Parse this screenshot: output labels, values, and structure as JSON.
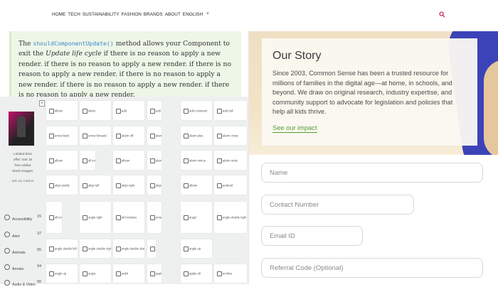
{
  "nav": {
    "items": [
      "HOME",
      "TECH",
      "SUSTAINABILITY",
      "FASHION",
      "BRANDS",
      "ABOUT",
      "ENGLISH"
    ],
    "chevron": "˅",
    "search_icon": "search-icon",
    "accent": "#c2185b"
  },
  "code": {
    "pre": "The ",
    "method": "shouldComponentUpdate()",
    "mid": " method allows your Component to exit the ",
    "em": "Update life cycle",
    "post": " if there is no reason to apply a new render. if there is no reason to apply a new render. if there is no reason to apply a new render. if there is no reason to apply a new render. if there is no reason to apply a new render. if there is no reason to apply a new render."
  },
  "ad": {
    "close": "x",
    "text": "Limited time offer: Get 10 free Adobe Stock images.",
    "by": "ads via Carbon"
  },
  "categories": [
    {
      "label": "Accessibility",
      "count": "15"
    },
    {
      "label": "Alert",
      "count": "37"
    },
    {
      "label": "Animals",
      "count": "65"
    },
    {
      "label": "Arrows",
      "count": "64"
    },
    {
      "label": "Audio & Video",
      "count": "56"
    }
  ],
  "tiles": [
    [
      "album",
      "alarm",
      "add",
      "add alarm",
      "add comment",
      "add call"
    ],
    [
      "arrow back",
      "arrow forward",
      "alarm off",
      "alarm on",
      "alarm plus",
      "alarm cross"
    ],
    [
      "album",
      "all inclusive",
      "album",
      "alarm",
      "alarm minus",
      "alarm mute"
    ],
    [
      "align justify",
      "align left",
      "align right",
      "align top",
      "album",
      "android"
    ],
    [
      "all inclusive",
      "angle right",
      "all inclusive",
      "amazon",
      "angel",
      "angle double right"
    ],
    [
      "angle double left",
      "angle double right",
      "angle double down",
      "angle",
      "angle up"
    ],
    [
      "angle up",
      "angry",
      "ankh",
      "apple",
      "apple alt",
      "archive"
    ]
  ],
  "story": {
    "title": "Our Story",
    "body": "Since 2003, Common Sense has been a trusted resource for millions of families in the digital age—at home, in schools, and beyond. We draw on original research, industry expertise, and community support to advocate for legislation and policies that help all kids thrive.",
    "link": "See our impact"
  },
  "form": {
    "name_placeholder": "Name",
    "contact_placeholder": "Contact Number",
    "email_placeholder": "Email ID",
    "referral_placeholder": "Referral Code (Optional)"
  },
  "colors": {
    "link_green": "#4a9a2e",
    "code_blue": "#3a8ac8",
    "hero_blue": "#3b43b8"
  }
}
